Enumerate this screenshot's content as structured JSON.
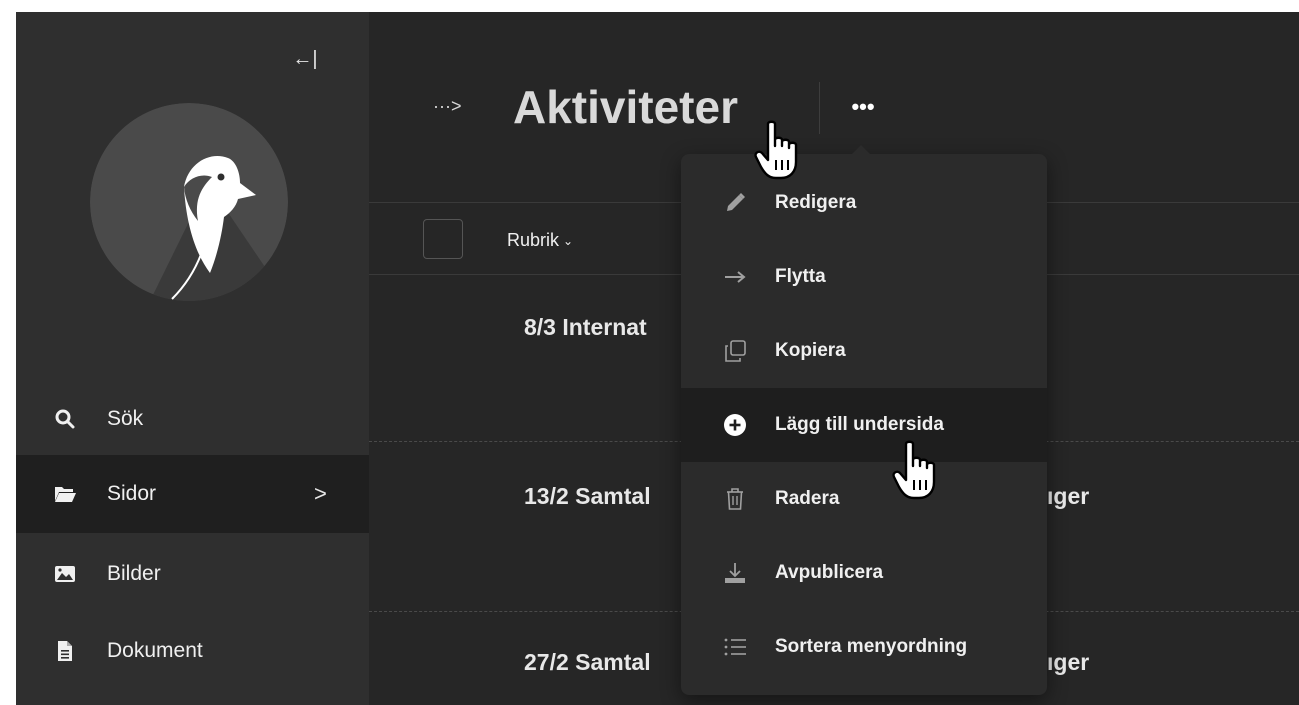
{
  "sidebar": {
    "collapse_glyph": "←|",
    "items": [
      {
        "label": "Sök",
        "icon": "search-icon"
      },
      {
        "label": "Sidor",
        "icon": "folder-icon",
        "chevron": ">"
      },
      {
        "label": "Bilder",
        "icon": "image-icon"
      },
      {
        "label": "Dokument",
        "icon": "document-icon"
      }
    ]
  },
  "header": {
    "breadcrumb_toggle": "···>",
    "title": "Aktiviteter",
    "more_glyph": "•••"
  },
  "table": {
    "column_header": "Rubrik",
    "column_chevron": "⌄",
    "rows": [
      {
        "title": "8/3 Internat",
        "tail": ""
      },
      {
        "title": "13/2 Samtal",
        "tail": "ıger"
      },
      {
        "title": "27/2 Samtal",
        "tail": "ıger"
      }
    ]
  },
  "menu": {
    "items": [
      {
        "label": "Redigera",
        "icon": "pencil-icon"
      },
      {
        "label": "Flytta",
        "icon": "arrow-right-icon"
      },
      {
        "label": "Kopiera",
        "icon": "copy-icon"
      },
      {
        "label": "Lägg till undersida",
        "icon": "plus-circle-icon"
      },
      {
        "label": "Radera",
        "icon": "trash-icon"
      },
      {
        "label": "Avpublicera",
        "icon": "download-icon"
      },
      {
        "label": "Sortera menyordning",
        "icon": "list-icon"
      }
    ]
  },
  "colors": {
    "background": "#262626",
    "sidebar": "#2f2f2f",
    "active_nav": "#1f1f1f",
    "menu_bg": "#2b2b2b",
    "menu_highlight": "#1e1e1e",
    "logo_circle": "#4a4a4a"
  }
}
